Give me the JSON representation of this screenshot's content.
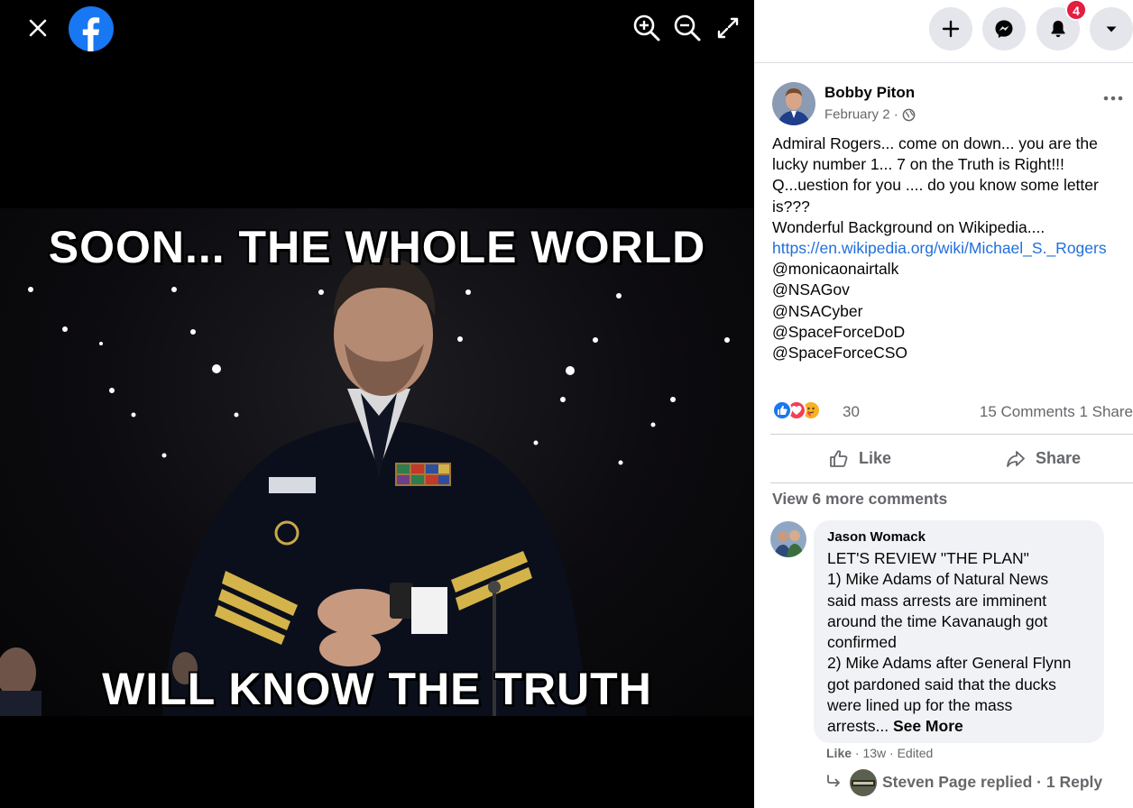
{
  "viewer": {
    "close_icon": "close-icon",
    "logo": "facebook-logo",
    "tools": [
      "zoom-in-icon",
      "zoom-out-icon",
      "fullscreen-icon"
    ]
  },
  "photo": {
    "top_text": "SOON... THE WHOLE WORLD",
    "bottom_text": "WILL KNOW THE TRUTH"
  },
  "header": {
    "buttons": [
      "plus-icon",
      "messenger-icon",
      "bell-icon",
      "caret-down-icon"
    ],
    "notification_count": "4",
    "colors": {
      "button_bg": "#e4e6eb",
      "badge": "#e41e3f"
    }
  },
  "post": {
    "author": "Bobby Piton",
    "date": "February 2 ·",
    "privacy_icon": "globe-icon",
    "body_lines": [
      "Admiral Rogers... come on down... you are the",
      "lucky number 1... 7 on the Truth is Right!!!",
      "Q...uestion for you .... do you know some letter",
      "is???",
      "Wonderful Background on Wikipedia...."
    ],
    "link": "https://en.wikipedia.org/wiki/Michael_S._Rogers",
    "mentions": [
      "@monicaonairtalk",
      "@NSAGov",
      "@NSACyber",
      "@SpaceForceDoD",
      "@SpaceForceCSO"
    ],
    "reaction_icons": [
      "like-reaction-icon",
      "love-reaction-icon",
      "care-reaction-icon"
    ],
    "reaction_count": "30",
    "comments_count": "15 Comments",
    "shares_count": "1 Share",
    "like_label": "Like",
    "share_label": "Share",
    "view_more": "View 6 more comments",
    "link_color": "#216fdb"
  },
  "comment": {
    "author": "Jason Womack",
    "lines": [
      "LET'S REVIEW \"THE PLAN\"",
      "1) Mike Adams of Natural News",
      "said mass arrests are imminent",
      "around the time Kavanaugh got",
      "confirmed",
      "2) Mike Adams after General Flynn",
      "got pardoned said that the ducks",
      "were lined up for the mass"
    ],
    "last_line": "arrests... ",
    "see_more": "See More",
    "like": "Like",
    "meta": " · 13w · Edited",
    "reply_text": "Steven Page replied · 1 Reply"
  }
}
